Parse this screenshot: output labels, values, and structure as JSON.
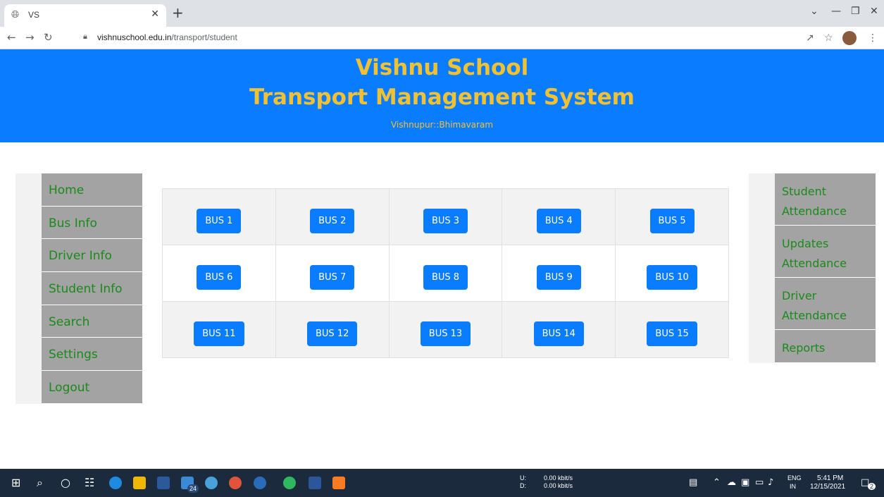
{
  "browser": {
    "tab_title": "VS",
    "url_host": "vishnuschool.edu.in",
    "url_path": "/transport/student"
  },
  "header": {
    "school": "Vishnu School",
    "system": "Transport Management System",
    "location": "Vishnupur::Bhimavaram"
  },
  "left_nav": [
    "Home",
    "Bus Info",
    "Driver Info",
    "Student Info",
    "Search",
    "Settings",
    "Logout"
  ],
  "right_nav": [
    [
      "Student",
      "Attendance"
    ],
    [
      "Updates",
      "Attendance"
    ],
    [
      "Driver",
      "Attendance"
    ],
    [
      "Reports"
    ]
  ],
  "buses": [
    [
      "BUS 1",
      "BUS 2",
      "BUS 3",
      "BUS 4",
      "BUS 5"
    ],
    [
      "BUS 6",
      "BUS 7",
      "BUS 8",
      "BUS 9",
      "BUS 10"
    ],
    [
      "BUS 11",
      "BUS 12",
      "BUS 13",
      "BUS 14",
      "BUS 15"
    ]
  ],
  "taskbar": {
    "net_up_label": "U:",
    "net_down_label": "D:",
    "net_up": "0.00 kbit/s",
    "net_down": "0.00 kbit/s",
    "lang": "ENG",
    "region": "IN",
    "time": "5:41 PM",
    "date": "12/15/2021",
    "badge_count": "24",
    "notif_count": "2"
  },
  "colors": {
    "header_bg": "#0a7cff",
    "header_text": "#f1c134",
    "nav_bg": "#a3a3a3",
    "nav_text": "#1a8a1a",
    "button_bg": "#0a7cff"
  }
}
